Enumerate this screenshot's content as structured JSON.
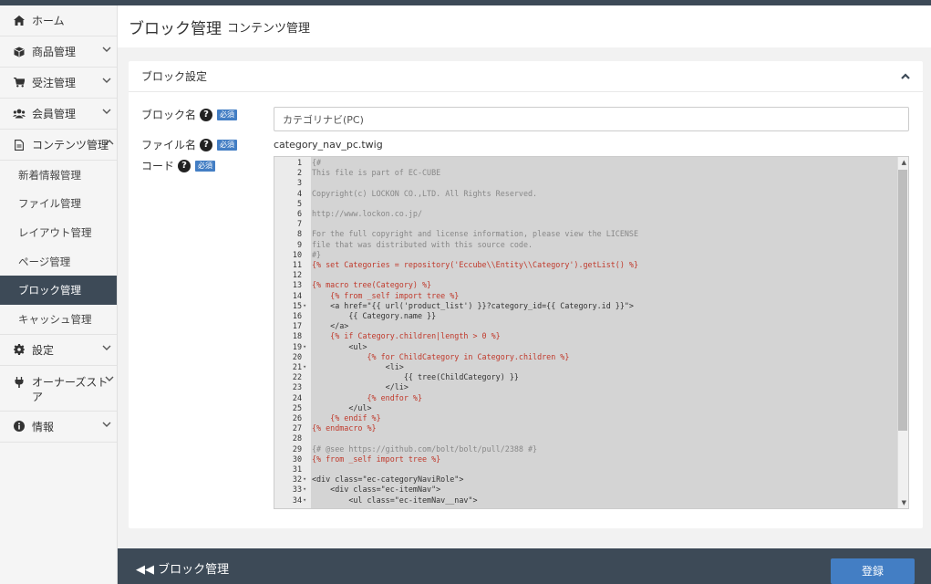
{
  "sidebar": {
    "home": "ホーム",
    "products": "商品管理",
    "orders": "受注管理",
    "customers": "会員管理",
    "content": "コンテンツ管理",
    "content_sub": [
      "新着情報管理",
      "ファイル管理",
      "レイアウト管理",
      "ページ管理",
      "ブロック管理",
      "キャッシュ管理"
    ],
    "settings": "設定",
    "owners_store": "オーナーズストア",
    "info": "情報"
  },
  "header": {
    "title": "ブロック管理",
    "subtitle": "コンテンツ管理"
  },
  "card": {
    "title": "ブロック設定",
    "block_name_label": "ブロック名",
    "file_name_label": "ファイル名",
    "code_label": "コード",
    "required": "必須",
    "help": "?",
    "block_name_value": "カテゴリナビ(PC)",
    "file_name_value": "category_nav_pc.twig"
  },
  "code_lines": [
    {
      "n": "1",
      "f": "",
      "t": "{#"
    },
    {
      "n": "2",
      "f": "",
      "t": "This file is part of EC-CUBE"
    },
    {
      "n": "3",
      "f": "",
      "t": ""
    },
    {
      "n": "4",
      "f": "",
      "t": "Copyright(c) LOCKON CO.,LTD. All Rights Reserved."
    },
    {
      "n": "5",
      "f": "",
      "t": ""
    },
    {
      "n": "6",
      "f": "",
      "t": "http://www.lockon.co.jp/"
    },
    {
      "n": "7",
      "f": "",
      "t": ""
    },
    {
      "n": "8",
      "f": "",
      "t": "For the full copyright and license information, please view the LICENSE"
    },
    {
      "n": "9",
      "f": "",
      "t": "file that was distributed with this source code."
    },
    {
      "n": "10",
      "f": "",
      "t": "#}"
    },
    {
      "n": "11",
      "f": "",
      "t": "{% set Categories = repository('Eccube\\\\Entity\\\\Category').getList() %}"
    },
    {
      "n": "12",
      "f": "",
      "t": ""
    },
    {
      "n": "13",
      "f": "",
      "t": "{% macro tree(Category) %}"
    },
    {
      "n": "14",
      "f": "",
      "t": "    {% from _self import tree %}"
    },
    {
      "n": "15",
      "f": "▾",
      "t": "    <a href=\"{{ url('product_list') }}?category_id={{ Category.id }}\">"
    },
    {
      "n": "16",
      "f": "",
      "t": "        {{ Category.name }}"
    },
    {
      "n": "17",
      "f": "",
      "t": "    </a>"
    },
    {
      "n": "18",
      "f": "",
      "t": "    {% if Category.children|length > 0 %}"
    },
    {
      "n": "19",
      "f": "▾",
      "t": "        <ul>"
    },
    {
      "n": "20",
      "f": "",
      "t": "            {% for ChildCategory in Category.children %}"
    },
    {
      "n": "21",
      "f": "▾",
      "t": "                <li>"
    },
    {
      "n": "22",
      "f": "",
      "t": "                    {{ tree(ChildCategory) }}"
    },
    {
      "n": "23",
      "f": "",
      "t": "                </li>"
    },
    {
      "n": "24",
      "f": "",
      "t": "            {% endfor %}"
    },
    {
      "n": "25",
      "f": "",
      "t": "        </ul>"
    },
    {
      "n": "26",
      "f": "",
      "t": "    {% endif %}"
    },
    {
      "n": "27",
      "f": "",
      "t": "{% endmacro %}"
    },
    {
      "n": "28",
      "f": "",
      "t": ""
    },
    {
      "n": "29",
      "f": "",
      "t": "{# @see https://github.com/bolt/bolt/pull/2388 #}"
    },
    {
      "n": "30",
      "f": "",
      "t": "{% from _self import tree %}"
    },
    {
      "n": "31",
      "f": "",
      "t": ""
    },
    {
      "n": "32",
      "f": "▾",
      "t": "<div class=\"ec-categoryNaviRole\">"
    },
    {
      "n": "33",
      "f": "▾",
      "t": "    <div class=\"ec-itemNav\">"
    },
    {
      "n": "34",
      "f": "▾",
      "t": "        <ul class=\"ec-itemNav__nav\">"
    }
  ],
  "footer": {
    "back": "ブロック管理",
    "save": "登録"
  }
}
